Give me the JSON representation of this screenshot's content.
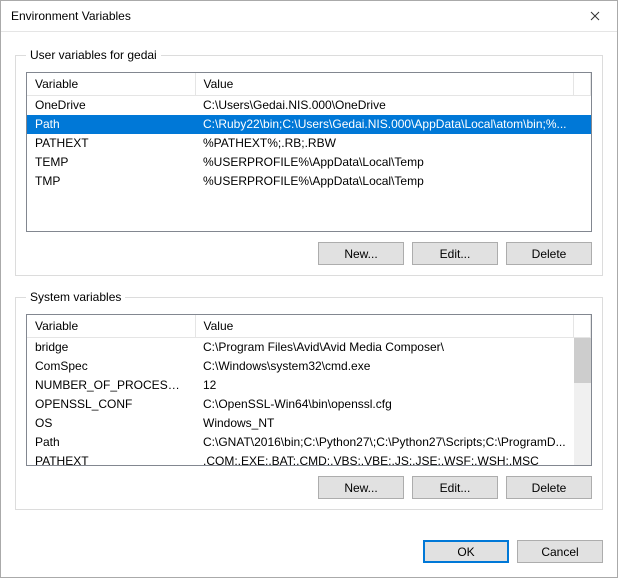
{
  "window": {
    "title": "Environment Variables"
  },
  "user": {
    "legend": "User variables for gedai",
    "headers": {
      "variable": "Variable",
      "value": "Value"
    },
    "rows": [
      {
        "variable": "OneDrive",
        "value": "C:\\Users\\Gedai.NIS.000\\OneDrive",
        "selected": false
      },
      {
        "variable": "Path",
        "value": "C:\\Ruby22\\bin;C:\\Users\\Gedai.NIS.000\\AppData\\Local\\atom\\bin;%...",
        "selected": true
      },
      {
        "variable": "PATHEXT",
        "value": "%PATHEXT%;.RB;.RBW",
        "selected": false
      },
      {
        "variable": "TEMP",
        "value": "%USERPROFILE%\\AppData\\Local\\Temp",
        "selected": false
      },
      {
        "variable": "TMP",
        "value": "%USERPROFILE%\\AppData\\Local\\Temp",
        "selected": false
      }
    ],
    "buttons": {
      "new": "New...",
      "edit": "Edit...",
      "delete": "Delete"
    }
  },
  "system": {
    "legend": "System variables",
    "headers": {
      "variable": "Variable",
      "value": "Value"
    },
    "rows": [
      {
        "variable": "bridge",
        "value": "C:\\Program Files\\Avid\\Avid Media Composer\\"
      },
      {
        "variable": "ComSpec",
        "value": "C:\\Windows\\system32\\cmd.exe"
      },
      {
        "variable": "NUMBER_OF_PROCESSORS",
        "value": "12"
      },
      {
        "variable": "OPENSSL_CONF",
        "value": "C:\\OpenSSL-Win64\\bin\\openssl.cfg"
      },
      {
        "variable": "OS",
        "value": "Windows_NT"
      },
      {
        "variable": "Path",
        "value": "C:\\GNAT\\2016\\bin;C:\\Python27\\;C:\\Python27\\Scripts;C:\\ProgramD..."
      },
      {
        "variable": "PATHEXT",
        "value": ".COM;.EXE;.BAT;.CMD;.VBS;.VBE;.JS;.JSE;.WSF;.WSH;.MSC"
      }
    ],
    "buttons": {
      "new": "New...",
      "edit": "Edit...",
      "delete": "Delete"
    }
  },
  "footer": {
    "ok": "OK",
    "cancel": "Cancel"
  }
}
